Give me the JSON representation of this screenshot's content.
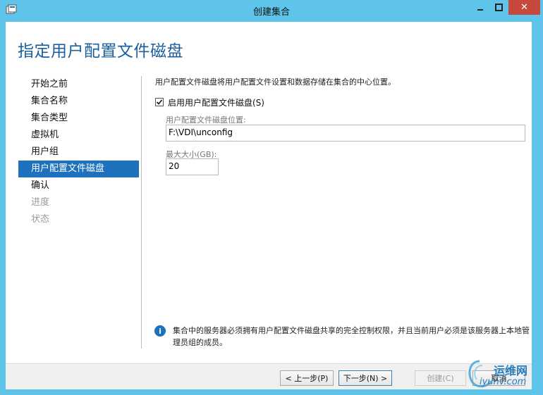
{
  "window": {
    "title": "创建集合",
    "close_symbol": "✕"
  },
  "page": {
    "heading": "指定用户配置文件磁盘",
    "description": "用户配置文件磁盘将用户配置文件设置和数据存储在集合的中心位置。"
  },
  "nav": {
    "items": [
      {
        "label": "开始之前",
        "state": "normal"
      },
      {
        "label": "集合名称",
        "state": "normal"
      },
      {
        "label": "集合类型",
        "state": "normal"
      },
      {
        "label": "虚拟机",
        "state": "normal"
      },
      {
        "label": "用户组",
        "state": "normal"
      },
      {
        "label": "用户配置文件磁盘",
        "state": "active"
      },
      {
        "label": "确认",
        "state": "normal"
      },
      {
        "label": "进度",
        "state": "disabled"
      },
      {
        "label": "状态",
        "state": "disabled"
      }
    ]
  },
  "form": {
    "enable_checkbox_label": "启用用户配置文件磁盘(S)",
    "enable_checked": true,
    "location_label": "用户配置文件磁盘位置:",
    "location_value": "F:\\VDI\\unconfig",
    "max_size_label": "最大大小(GB):",
    "max_size_value": "20"
  },
  "info": {
    "icon": "info-icon",
    "text": "集合中的服务器必须拥有用户配置文件磁盘共享的完全控制权限，并且当前用户必须是该服务器上本地管理员组的成员。"
  },
  "footer": {
    "prev_label": "< 上一步(P)",
    "next_label": "下一步(N) >",
    "create_label": "创建(C)",
    "cancel_label": "取消"
  },
  "watermark": {
    "line1": "运维网",
    "line2": "iyunv.com"
  },
  "colors": {
    "titlebar": "#5fc4ea",
    "heading": "#1a5fa0",
    "nav_active": "#1e72bd",
    "close_button": "#c7483c"
  }
}
